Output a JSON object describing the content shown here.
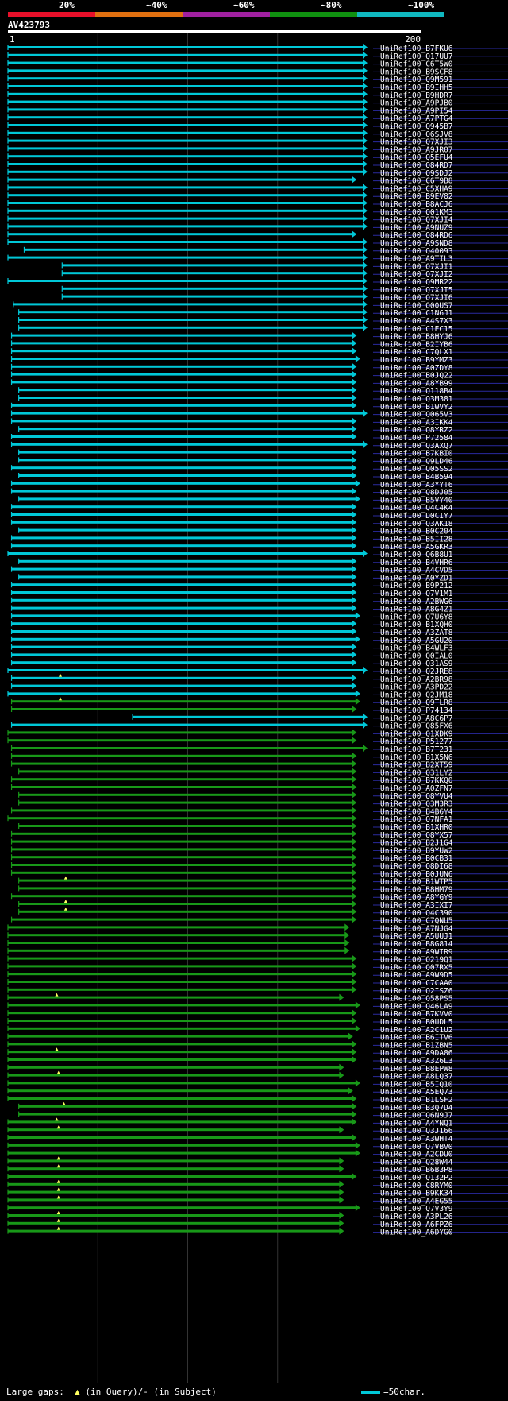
{
  "legend": {
    "labels": [
      "20%",
      "~40%",
      "~60%",
      "~80%",
      "~100%"
    ],
    "colors": [
      "#e8102a",
      "#e07010",
      "#a020a0",
      "#109010",
      "#10b8c0"
    ]
  },
  "query": {
    "name": "AV423793",
    "start_label": "1",
    "end_label": "200"
  },
  "footer": {
    "gaps_label": "Large gaps:",
    "gaps_desc": "(in Query)/- (in Subject)",
    "scale_label": "=50char."
  },
  "chart_data": {
    "type": "alignment",
    "query_length": 200,
    "colors": {
      "high": "#00c8d8",
      "mid": "#189818",
      "gap_marker": "#ffff60",
      "row_line": "#2a2aa0"
    },
    "hits": [
      {
        "name": "UniRef100_B7FKU6",
        "start": 1,
        "end": 200,
        "cls": "high"
      },
      {
        "name": "UniRef100_Q17UU7",
        "start": 1,
        "end": 200,
        "cls": "high"
      },
      {
        "name": "UniRef100_C6T5W0",
        "start": 1,
        "end": 200,
        "cls": "high"
      },
      {
        "name": "UniRef100_B9SCF8",
        "start": 1,
        "end": 200,
        "cls": "high"
      },
      {
        "name": "UniRef100_Q9M591",
        "start": 1,
        "end": 200,
        "cls": "high"
      },
      {
        "name": "UniRef100_B9IHH5",
        "start": 1,
        "end": 200,
        "cls": "high"
      },
      {
        "name": "UniRef100_B9HDR7",
        "start": 1,
        "end": 200,
        "cls": "high"
      },
      {
        "name": "UniRef100_A9PJB0",
        "start": 1,
        "end": 200,
        "cls": "high"
      },
      {
        "name": "UniRef100_A9PI54",
        "start": 1,
        "end": 200,
        "cls": "high"
      },
      {
        "name": "UniRef100_A7PTG4",
        "start": 1,
        "end": 200,
        "cls": "high"
      },
      {
        "name": "UniRef100_Q945B7",
        "start": 1,
        "end": 200,
        "cls": "high"
      },
      {
        "name": "UniRef100_Q6SJV8",
        "start": 1,
        "end": 200,
        "cls": "high"
      },
      {
        "name": "UniRef100_Q7XJI3",
        "start": 1,
        "end": 200,
        "cls": "high"
      },
      {
        "name": "UniRef100_A9JR07",
        "start": 1,
        "end": 200,
        "cls": "high"
      },
      {
        "name": "UniRef100_Q5EFU4",
        "start": 1,
        "end": 200,
        "cls": "high"
      },
      {
        "name": "UniRef100_Q84RD7",
        "start": 1,
        "end": 200,
        "cls": "high"
      },
      {
        "name": "UniRef100_Q9SDJ2",
        "start": 1,
        "end": 200,
        "cls": "high"
      },
      {
        "name": "UniRef100_C6T9B8",
        "start": 1,
        "end": 194,
        "cls": "high"
      },
      {
        "name": "UniRef100_C5XHA9",
        "start": 1,
        "end": 200,
        "cls": "high"
      },
      {
        "name": "UniRef100_B9EV82",
        "start": 1,
        "end": 200,
        "cls": "high"
      },
      {
        "name": "UniRef100_B8ACJ6",
        "start": 1,
        "end": 200,
        "cls": "high"
      },
      {
        "name": "UniRef100_Q01KM3",
        "start": 1,
        "end": 200,
        "cls": "high"
      },
      {
        "name": "UniRef100_Q7XJI4",
        "start": 1,
        "end": 200,
        "cls": "high"
      },
      {
        "name": "UniRef100_A9NUZ9",
        "start": 1,
        "end": 200,
        "cls": "high"
      },
      {
        "name": "UniRef100_Q84RD6",
        "start": 1,
        "end": 194,
        "cls": "high"
      },
      {
        "name": "UniRef100_A9SND8",
        "start": 1,
        "end": 200,
        "cls": "high"
      },
      {
        "name": "UniRef100_Q40093",
        "start": 10,
        "end": 200,
        "cls": "high"
      },
      {
        "name": "UniRef100_A9TIL3",
        "start": 1,
        "end": 200,
        "cls": "high"
      },
      {
        "name": "UniRef100_Q7XJI1",
        "start": 31,
        "end": 200,
        "cls": "high"
      },
      {
        "name": "UniRef100_Q7XJI2",
        "start": 31,
        "end": 200,
        "cls": "high"
      },
      {
        "name": "UniRef100_Q9MR22",
        "start": 1,
        "end": 200,
        "cls": "high"
      },
      {
        "name": "UniRef100_Q7XJI5",
        "start": 31,
        "end": 200,
        "cls": "high"
      },
      {
        "name": "UniRef100_Q7XJI6",
        "start": 31,
        "end": 200,
        "cls": "high"
      },
      {
        "name": "UniRef100_Q00US7",
        "start": 4,
        "end": 200,
        "cls": "high"
      },
      {
        "name": "UniRef100_C1N6J1",
        "start": 7,
        "end": 200,
        "cls": "high"
      },
      {
        "name": "UniRef100_A4S7X3",
        "start": 7,
        "end": 200,
        "cls": "high"
      },
      {
        "name": "UniRef100_C1EC15",
        "start": 7,
        "end": 200,
        "cls": "high"
      },
      {
        "name": "UniRef100_B8HYJ6",
        "start": 3,
        "end": 194,
        "cls": "high"
      },
      {
        "name": "UniRef100_B2IYB6",
        "start": 3,
        "end": 194,
        "cls": "high"
      },
      {
        "name": "UniRef100_C7QLX1",
        "start": 3,
        "end": 194,
        "cls": "high"
      },
      {
        "name": "UniRef100_B9YMZ3",
        "start": 3,
        "end": 196,
        "cls": "high"
      },
      {
        "name": "UniRef100_A0ZDY8",
        "start": 3,
        "end": 194,
        "cls": "high"
      },
      {
        "name": "UniRef100_B0JQ22",
        "start": 3,
        "end": 194,
        "cls": "high"
      },
      {
        "name": "UniRef100_A8YB99",
        "start": 3,
        "end": 194,
        "cls": "high"
      },
      {
        "name": "UniRef100_Q118B4",
        "start": 7,
        "end": 194,
        "cls": "high"
      },
      {
        "name": "UniRef100_Q3M381",
        "start": 7,
        "end": 194,
        "cls": "high"
      },
      {
        "name": "UniRef100_B1WVY2",
        "start": 3,
        "end": 194,
        "cls": "high"
      },
      {
        "name": "UniRef100_Q065V3",
        "start": 3,
        "end": 200,
        "cls": "high"
      },
      {
        "name": "UniRef100_A3IKK4",
        "start": 3,
        "end": 194,
        "cls": "high"
      },
      {
        "name": "UniRef100_Q8YRZ2",
        "start": 7,
        "end": 194,
        "cls": "high"
      },
      {
        "name": "UniRef100_P72584",
        "start": 3,
        "end": 194,
        "cls": "high"
      },
      {
        "name": "UniRef100_Q3AXQ7",
        "start": 3,
        "end": 200,
        "cls": "high"
      },
      {
        "name": "UniRef100_B7KBI0",
        "start": 7,
        "end": 194,
        "cls": "high"
      },
      {
        "name": "UniRef100_Q9LD46",
        "start": 7,
        "end": 194,
        "cls": "high"
      },
      {
        "name": "UniRef100_Q05SS2",
        "start": 3,
        "end": 194,
        "cls": "high"
      },
      {
        "name": "UniRef100_B4B594",
        "start": 7,
        "end": 194,
        "cls": "high"
      },
      {
        "name": "UniRef100_A3YYT6",
        "start": 3,
        "end": 196,
        "cls": "high"
      },
      {
        "name": "UniRef100_Q8DJ05",
        "start": 3,
        "end": 194,
        "cls": "high"
      },
      {
        "name": "UniRef100_B5VY40",
        "start": 7,
        "end": 196,
        "cls": "high"
      },
      {
        "name": "UniRef100_Q4C4K4",
        "start": 3,
        "end": 194,
        "cls": "high"
      },
      {
        "name": "UniRef100_D0CIY7",
        "start": 3,
        "end": 194,
        "cls": "high"
      },
      {
        "name": "UniRef100_Q3AK18",
        "start": 3,
        "end": 194,
        "cls": "high"
      },
      {
        "name": "UniRef100_B0C204",
        "start": 7,
        "end": 194,
        "cls": "high"
      },
      {
        "name": "UniRef100_B5II28",
        "start": 3,
        "end": 194,
        "cls": "high"
      },
      {
        "name": "UniRef100_A5GKR3",
        "start": 3,
        "end": 194,
        "cls": "high"
      },
      {
        "name": "UniRef100_Q6B8U1",
        "start": 1,
        "end": 200,
        "cls": "high"
      },
      {
        "name": "UniRef100_B4VHR6",
        "start": 7,
        "end": 194,
        "cls": "high"
      },
      {
        "name": "UniRef100_A4CVD5",
        "start": 3,
        "end": 194,
        "cls": "high"
      },
      {
        "name": "UniRef100_A0YZD1",
        "start": 7,
        "end": 194,
        "cls": "high"
      },
      {
        "name": "UniRef100_B9P212",
        "start": 3,
        "end": 194,
        "cls": "high"
      },
      {
        "name": "UniRef100_Q7V1M1",
        "start": 3,
        "end": 194,
        "cls": "high"
      },
      {
        "name": "UniRef100_A2BWG6",
        "start": 3,
        "end": 194,
        "cls": "high"
      },
      {
        "name": "UniRef100_A8G4Z1",
        "start": 3,
        "end": 194,
        "cls": "high"
      },
      {
        "name": "UniRef100_Q7U6Y8",
        "start": 3,
        "end": 196,
        "cls": "high"
      },
      {
        "name": "UniRef100_B1XQH0",
        "start": 3,
        "end": 194,
        "cls": "high"
      },
      {
        "name": "UniRef100_A3ZAT8",
        "start": 3,
        "end": 194,
        "cls": "high"
      },
      {
        "name": "UniRef100_A5GU20",
        "start": 3,
        "end": 196,
        "cls": "high"
      },
      {
        "name": "UniRef100_B4WLF3",
        "start": 3,
        "end": 194,
        "cls": "high"
      },
      {
        "name": "UniRef100_Q0IAL0",
        "start": 3,
        "end": 194,
        "cls": "high"
      },
      {
        "name": "UniRef100_Q31AS9",
        "start": 3,
        "end": 194,
        "cls": "high"
      },
      {
        "name": "UniRef100_Q2JRE8",
        "start": 1,
        "end": 200,
        "cls": "high"
      },
      {
        "name": "UniRef100_A2BR98",
        "start": 3,
        "end": 194,
        "cls": "high",
        "gap": 30
      },
      {
        "name": "UniRef100_A3PD22",
        "start": 3,
        "end": 194,
        "cls": "high"
      },
      {
        "name": "UniRef100_Q2JM18",
        "start": 1,
        "end": 196,
        "cls": "high"
      },
      {
        "name": "UniRef100_Q9TLR8",
        "start": 3,
        "end": 196,
        "cls": "mid",
        "gap": 30
      },
      {
        "name": "UniRef100_P74134",
        "start": 3,
        "end": 194,
        "cls": "mid"
      },
      {
        "name": "UniRef100_A8C6P7",
        "start": 70,
        "end": 200,
        "cls": "high"
      },
      {
        "name": "UniRef100_Q85FX6",
        "start": 3,
        "end": 200,
        "cls": "high"
      },
      {
        "name": "UniRef100_Q1XDK9",
        "start": 1,
        "end": 194,
        "cls": "mid"
      },
      {
        "name": "UniRef100_P51277",
        "start": 1,
        "end": 194,
        "cls": "mid"
      },
      {
        "name": "UniRef100_B7T231",
        "start": 3,
        "end": 200,
        "cls": "mid"
      },
      {
        "name": "UniRef100_B1X5N6",
        "start": 3,
        "end": 194,
        "cls": "mid"
      },
      {
        "name": "UniRef100_B2XT59",
        "start": 3,
        "end": 194,
        "cls": "mid"
      },
      {
        "name": "UniRef100_Q31LY2",
        "start": 7,
        "end": 194,
        "cls": "mid"
      },
      {
        "name": "UniRef100_B7KKQ0",
        "start": 3,
        "end": 194,
        "cls": "mid"
      },
      {
        "name": "UniRef100_A0ZFN7",
        "start": 3,
        "end": 194,
        "cls": "mid"
      },
      {
        "name": "UniRef100_Q8YVU4",
        "start": 7,
        "end": 194,
        "cls": "mid"
      },
      {
        "name": "UniRef100_Q3M3R3",
        "start": 7,
        "end": 194,
        "cls": "mid"
      },
      {
        "name": "UniRef100_B4B6Y4",
        "start": 3,
        "end": 194,
        "cls": "mid"
      },
      {
        "name": "UniRef100_Q7NFA1",
        "start": 1,
        "end": 194,
        "cls": "mid"
      },
      {
        "name": "UniRef100_B1XHR0",
        "start": 7,
        "end": 194,
        "cls": "mid"
      },
      {
        "name": "UniRef100_Q8YX57",
        "start": 3,
        "end": 194,
        "cls": "mid"
      },
      {
        "name": "UniRef100_B2J1G4",
        "start": 3,
        "end": 194,
        "cls": "mid"
      },
      {
        "name": "UniRef100_B9YUW2",
        "start": 3,
        "end": 194,
        "cls": "mid"
      },
      {
        "name": "UniRef100_B0CB31",
        "start": 3,
        "end": 194,
        "cls": "mid"
      },
      {
        "name": "UniRef100_Q8DI68",
        "start": 3,
        "end": 194,
        "cls": "mid"
      },
      {
        "name": "UniRef100_B0JUN6",
        "start": 3,
        "end": 194,
        "cls": "mid"
      },
      {
        "name": "UniRef100_B1WTP5",
        "start": 7,
        "end": 194,
        "cls": "mid",
        "gap": 33
      },
      {
        "name": "UniRef100_B8HM79",
        "start": 7,
        "end": 194,
        "cls": "mid"
      },
      {
        "name": "UniRef100_A8YGY9",
        "start": 3,
        "end": 194,
        "cls": "mid"
      },
      {
        "name": "UniRef100_A3IXI7",
        "start": 7,
        "end": 194,
        "cls": "mid",
        "gap": 33
      },
      {
        "name": "UniRef100_Q4C390",
        "start": 7,
        "end": 194,
        "cls": "mid",
        "gap": 33
      },
      {
        "name": "UniRef100_C7QNU5",
        "start": 3,
        "end": 194,
        "cls": "mid"
      },
      {
        "name": "UniRef100_A7NJG4",
        "start": 1,
        "end": 190,
        "cls": "mid"
      },
      {
        "name": "UniRef100_A5UUJ1",
        "start": 1,
        "end": 190,
        "cls": "mid"
      },
      {
        "name": "UniRef100_B8G814",
        "start": 1,
        "end": 190,
        "cls": "mid"
      },
      {
        "name": "UniRef100_A9WIR9",
        "start": 1,
        "end": 190,
        "cls": "mid"
      },
      {
        "name": "UniRef100_Q219Q1",
        "start": 1,
        "end": 194,
        "cls": "mid"
      },
      {
        "name": "UniRef100_Q07RX5",
        "start": 1,
        "end": 194,
        "cls": "mid"
      },
      {
        "name": "UniRef100_A9W9D5",
        "start": 1,
        "end": 194,
        "cls": "mid"
      },
      {
        "name": "UniRef100_C7CAA0",
        "start": 1,
        "end": 194,
        "cls": "mid"
      },
      {
        "name": "UniRef100_Q2ISZ6",
        "start": 1,
        "end": 194,
        "cls": "mid"
      },
      {
        "name": "UniRef100_Q58PS5",
        "start": 1,
        "end": 187,
        "cls": "mid",
        "gap": 28
      },
      {
        "name": "UniRef100_Q46LA9",
        "start": 1,
        "end": 196,
        "cls": "mid"
      },
      {
        "name": "UniRef100_B7KVV0",
        "start": 1,
        "end": 194,
        "cls": "mid"
      },
      {
        "name": "UniRef100_B0UDL5",
        "start": 1,
        "end": 194,
        "cls": "mid"
      },
      {
        "name": "UniRef100_A2C1U2",
        "start": 1,
        "end": 196,
        "cls": "mid"
      },
      {
        "name": "UniRef100_B6ITV6",
        "start": 1,
        "end": 192,
        "cls": "mid"
      },
      {
        "name": "UniRef100_B1ZBN5",
        "start": 1,
        "end": 194,
        "cls": "mid"
      },
      {
        "name": "UniRef100_A9DA86",
        "start": 1,
        "end": 194,
        "cls": "mid",
        "gap": 28
      },
      {
        "name": "UniRef100_A3Z6L3",
        "start": 1,
        "end": 194,
        "cls": "mid"
      },
      {
        "name": "UniRef100_B8EPW8",
        "start": 1,
        "end": 187,
        "cls": "mid"
      },
      {
        "name": "UniRef100_A8LQ37",
        "start": 1,
        "end": 187,
        "cls": "mid",
        "gap": 29
      },
      {
        "name": "UniRef100_B5IQ10",
        "start": 1,
        "end": 196,
        "cls": "mid"
      },
      {
        "name": "UniRef100_A5EQ73",
        "start": 1,
        "end": 192,
        "cls": "mid"
      },
      {
        "name": "UniRef100_B1LSF2",
        "start": 1,
        "end": 194,
        "cls": "mid"
      },
      {
        "name": "UniRef100_B3Q7D4",
        "start": 7,
        "end": 194,
        "cls": "mid",
        "gap": 32
      },
      {
        "name": "UniRef100_Q6N9J7",
        "start": 7,
        "end": 194,
        "cls": "mid"
      },
      {
        "name": "UniRef100_A4YNQ1",
        "start": 1,
        "end": 194,
        "cls": "mid",
        "gap": 28
      },
      {
        "name": "UniRef100_Q3J166",
        "start": 1,
        "end": 187,
        "cls": "mid",
        "gap": 29
      },
      {
        "name": "UniRef100_A3WHT4",
        "start": 1,
        "end": 194,
        "cls": "mid"
      },
      {
        "name": "UniRef100_Q7VBV0",
        "start": 1,
        "end": 196,
        "cls": "mid"
      },
      {
        "name": "UniRef100_A2CDU0",
        "start": 1,
        "end": 196,
        "cls": "mid"
      },
      {
        "name": "UniRef100_Q28W44",
        "start": 1,
        "end": 187,
        "cls": "mid",
        "gap": 29
      },
      {
        "name": "UniRef100_B6B3P8",
        "start": 1,
        "end": 187,
        "cls": "mid",
        "gap": 29
      },
      {
        "name": "UniRef100_Q132P2",
        "start": 1,
        "end": 194,
        "cls": "mid"
      },
      {
        "name": "UniRef100_C8RYM0",
        "start": 1,
        "end": 187,
        "cls": "mid",
        "gap": 29
      },
      {
        "name": "UniRef100_B9KK34",
        "start": 1,
        "end": 187,
        "cls": "mid",
        "gap": 29
      },
      {
        "name": "UniRef100_A4EG55",
        "start": 1,
        "end": 187,
        "cls": "mid",
        "gap": 29
      },
      {
        "name": "UniRef100_Q7V3Y9",
        "start": 1,
        "end": 196,
        "cls": "mid"
      },
      {
        "name": "UniRef100_A3PL26",
        "start": 1,
        "end": 187,
        "cls": "mid",
        "gap": 29
      },
      {
        "name": "UniRef100_A6FPZ6",
        "start": 1,
        "end": 187,
        "cls": "mid",
        "gap": 29
      },
      {
        "name": "UniRef100_A6DYG0",
        "start": 1,
        "end": 187,
        "cls": "mid",
        "gap": 29
      }
    ]
  }
}
